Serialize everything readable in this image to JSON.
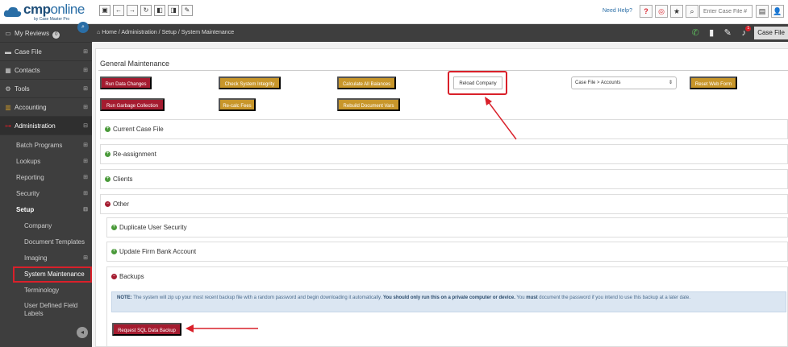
{
  "app": {
    "logo_main": "cmp",
    "logo_suffix": "online",
    "logo_sub": "by Case Master Pro",
    "need_help": "Need Help?",
    "case_search_placeholder": "Enter Case File #"
  },
  "sidebar": {
    "items": [
      {
        "label": "My Reviews",
        "badge": "0"
      },
      {
        "label": "Case File"
      },
      {
        "label": "Contacts"
      },
      {
        "label": "Tools"
      },
      {
        "label": "Accounting"
      },
      {
        "label": "Administration"
      }
    ],
    "admin_sub": [
      {
        "label": "Batch Programs"
      },
      {
        "label": "Lookups"
      },
      {
        "label": "Reporting"
      },
      {
        "label": "Security"
      },
      {
        "label": "Setup"
      }
    ],
    "setup_sub": [
      {
        "label": "Company"
      },
      {
        "label": "Document Templates"
      },
      {
        "label": "Imaging"
      },
      {
        "label": "System Maintenance"
      },
      {
        "label": "Terminology"
      },
      {
        "label": "User Defined Field Labels"
      }
    ]
  },
  "breadcrumb": {
    "home": "Home",
    "sep": "/",
    "c1": "Administration",
    "c2": "Setup",
    "c3": "System Maintenance"
  },
  "header_right": {
    "case_file_tab": "Case File",
    "notif_count": "1"
  },
  "general_maintenance": {
    "title": "General Maintenance",
    "buttons": {
      "run_data_changes": "Run Data Changes",
      "check_system_integrity": "Check System Integrity",
      "calculate_all_balances": "Calculate All Balances",
      "reload_company": "Reload Company",
      "reset_web_form": "Reset Web Form",
      "run_garbage_collection": "Run Garbage Collection",
      "recalc_fees": "Re-calc Fees",
      "rebuild_document_vars": "Rebuild Document Vars"
    },
    "select_value": "Case File > Accounts"
  },
  "sections": {
    "current_case_file": "Current Case File",
    "reassignment": "Re-assignment",
    "clients": "Clients",
    "other": "Other",
    "duplicate_user_security": "Duplicate User Security",
    "update_firm_bank_account": "Update Firm Bank Account",
    "backups": "Backups"
  },
  "note": {
    "label": "NOTE:",
    "text1": " The system will zip up your most recent backup file with a random password and begin downloading it automatically. ",
    "bold1": "You should only run this on a private computer or device.",
    "text2": " You ",
    "bold2": "must",
    "text3": " document the password if you intend to use this backup at a later date."
  },
  "backup_button": "Request SQL Data Backup",
  "colors": {
    "red_btn": "#a51c30",
    "gold_btn": "#c8962a",
    "highlight": "#d9202a",
    "sidebar_bg": "#3e3e3e"
  }
}
